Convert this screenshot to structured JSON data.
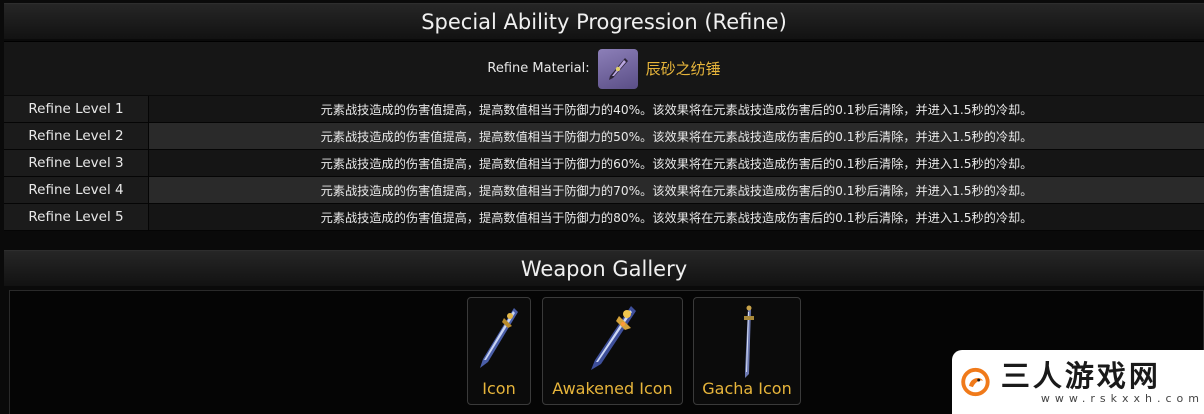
{
  "refine_section": {
    "title": "Special Ability Progression (Refine)",
    "material_label": "Refine Material:",
    "material_name": "辰砂之纺锤",
    "levels": [
      {
        "label": "Refine Level 1",
        "text": "元素战技造成的伤害值提高，提高数值相当于防御力的40%。该效果将在元素战技造成伤害后的0.1秒后清除，并进入1.5秒的冷却。"
      },
      {
        "label": "Refine Level 2",
        "text": "元素战技造成的伤害值提高，提高数值相当于防御力的50%。该效果将在元素战技造成伤害后的0.1秒后清除，并进入1.5秒的冷却。"
      },
      {
        "label": "Refine Level 3",
        "text": "元素战技造成的伤害值提高，提高数值相当于防御力的60%。该效果将在元素战技造成伤害后的0.1秒后清除，并进入1.5秒的冷却。"
      },
      {
        "label": "Refine Level 4",
        "text": "元素战技造成的伤害值提高，提高数值相当于防御力的70%。该效果将在元素战技造成伤害后的0.1秒后清除，并进入1.5秒的冷却。"
      },
      {
        "label": "Refine Level 5",
        "text": "元素战技造成的伤害值提高，提高数值相当于防御力的80%。该效果将在元素战技造成伤害后的0.1秒后清除，并进入1.5秒的冷却。"
      }
    ]
  },
  "gallery_section": {
    "title": "Weapon Gallery",
    "items": [
      {
        "caption": "Icon",
        "icon": "sword-icon"
      },
      {
        "caption": "Awakened Icon",
        "icon": "sword-awakened-icon"
      },
      {
        "caption": "Gacha Icon",
        "icon": "sword-gacha-icon"
      }
    ]
  },
  "watermark": {
    "text": "三人游戏网",
    "url": "www.rskxxh.com"
  },
  "colors": {
    "accent_gold": "#e7b53b",
    "background": "#0a0a0a",
    "watermark_orange": "#f07a1a"
  }
}
